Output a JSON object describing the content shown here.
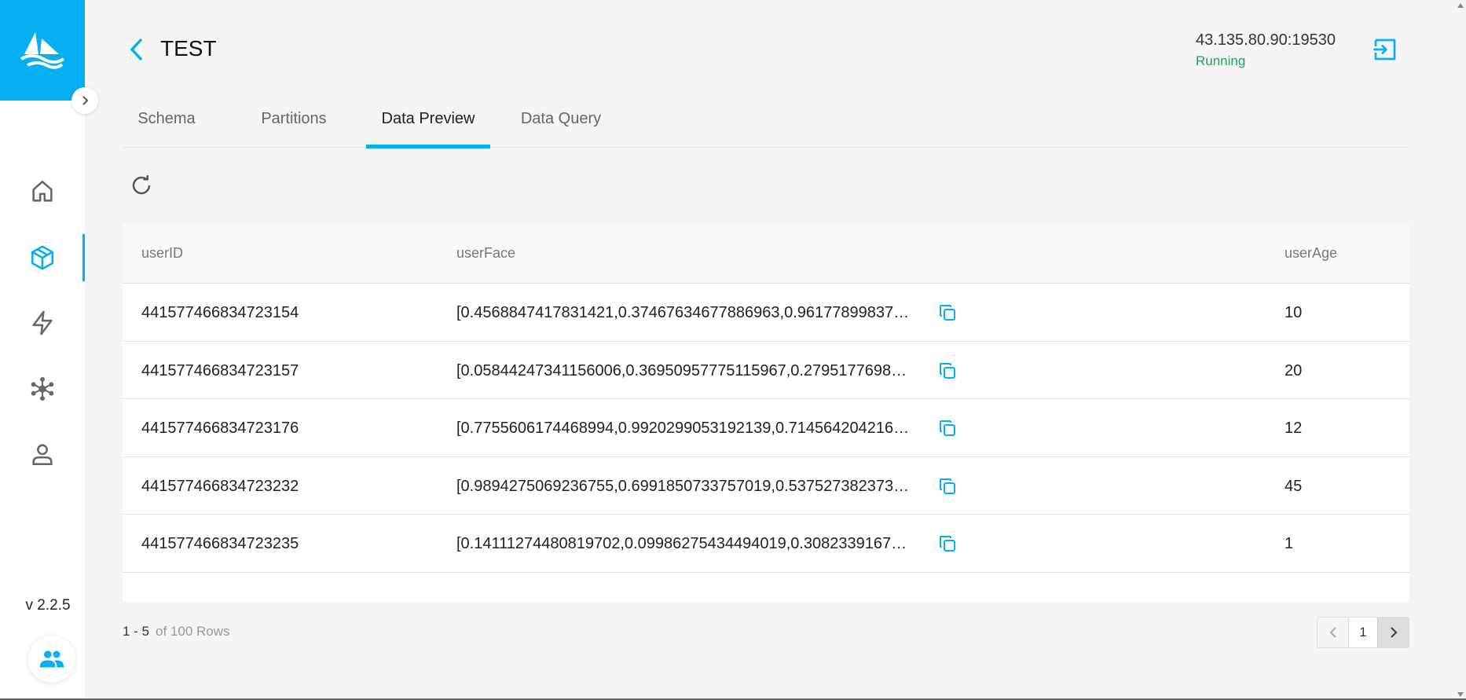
{
  "app": {
    "version": "v 2.2.5",
    "accent": "#06aff2",
    "status_color": "#21a55a"
  },
  "sidebar": {
    "logo_icon": "milvus-sail-logo-icon",
    "items": [
      {
        "name": "home",
        "icon": "home-icon",
        "active": false
      },
      {
        "name": "collections",
        "icon": "cube-icon",
        "active": true
      },
      {
        "name": "search",
        "icon": "lightning-icon",
        "active": false
      },
      {
        "name": "system",
        "icon": "network-icon",
        "active": false
      },
      {
        "name": "users",
        "icon": "person-icon",
        "active": false
      }
    ]
  },
  "header": {
    "title": "TEST",
    "address": "43.135.80.90:19530",
    "status": "Running"
  },
  "tabs": [
    {
      "label": "Schema",
      "active": false
    },
    {
      "label": "Partitions",
      "active": false
    },
    {
      "label": "Data Preview",
      "active": true
    },
    {
      "label": "Data Query",
      "active": false
    }
  ],
  "table": {
    "columns": [
      "userID",
      "userFace",
      "userAge"
    ],
    "rows": [
      [
        "441577466834723154",
        "[0.4568847417831421,0.37467634677886963,0.96177899837…",
        "10"
      ],
      [
        "441577466834723157",
        "[0.05844247341156006,0.36950957775115967,0.2795177698…",
        "20"
      ],
      [
        "441577466834723176",
        "[0.7755606174468994,0.9920299053192139,0.714564204216…",
        "12"
      ],
      [
        "441577466834723232",
        "[0.9894275069236755,0.6991850733757019,0.537527382373…",
        "45"
      ],
      [
        "441577466834723235",
        "[0.14111274480819702,0.09986275434494019,0.3082339167…",
        "1"
      ]
    ]
  },
  "footer": {
    "range": "1 - 5",
    "total": "of 100 Rows",
    "page": "1"
  }
}
